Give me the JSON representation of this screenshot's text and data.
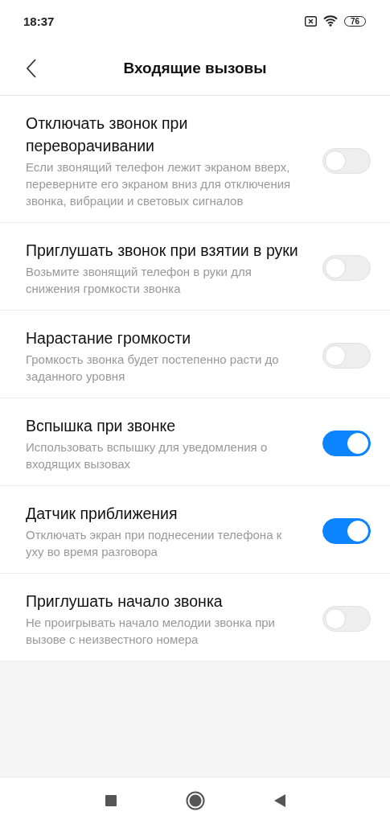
{
  "status_bar": {
    "time": "18:37",
    "battery": "76"
  },
  "header": {
    "title": "Входящие вызовы"
  },
  "settings": [
    {
      "title": "Отключать звонок при переворачивании",
      "description": "Если звонящий телефон лежит экраном вверх, переверните его экраном вниз для отключения звонка, вибрации и световых сигналов",
      "on": false
    },
    {
      "title": "Приглушать звонок при взятии в руки",
      "description": "Возьмите звонящий телефон в руки для снижения громкости звонка",
      "on": false
    },
    {
      "title": "Нарастание громкости",
      "description": "Громкость звонка будет постепенно расти до заданного уровня",
      "on": false
    },
    {
      "title": "Вспышка при звонке",
      "description": "Использовать вспышку для уведомления о входящих вызовах",
      "on": true
    },
    {
      "title": "Датчик приближения",
      "description": "Отключать экран при поднесении телефона к уху во время разговора",
      "on": true
    },
    {
      "title": "Приглушать начало звонка",
      "description": "Не проигрывать начало мелодии звонка при вызове с неизвестного номера",
      "on": false
    }
  ]
}
